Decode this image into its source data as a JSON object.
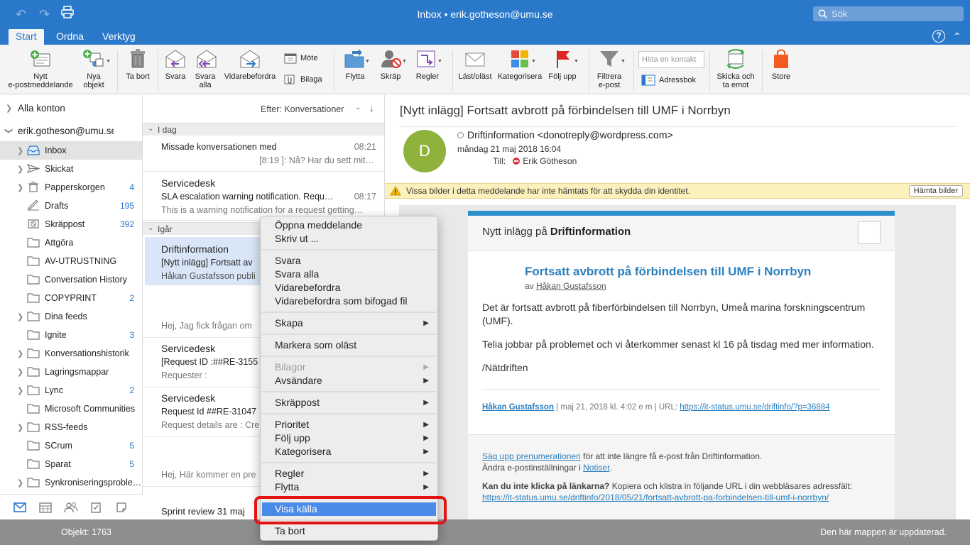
{
  "titlebar": {
    "title": "Inbox • erik.gotheson@umu.se",
    "search_placeholder": "Sök"
  },
  "ribbon_tabs": [
    "Start",
    "Ordna",
    "Verktyg"
  ],
  "ribbon": {
    "new_email": [
      "Nytt",
      "e-postmeddelande"
    ],
    "new_items": [
      "Nya",
      "objekt"
    ],
    "delete": "Ta bort",
    "reply": "Svara",
    "reply_all": [
      "Svara",
      "alla"
    ],
    "forward": "Vidarebefordra",
    "meeting": "Möte",
    "attachment": "Bilaga",
    "move": "Flytta",
    "junk": "Skräp",
    "rules": "Regler",
    "read_unread": "Läst/oläst",
    "categorize": "Kategorisera",
    "follow_up": "Följ upp",
    "filter": [
      "Filtrera",
      "e-post"
    ],
    "people_search_placeholder": "Hitta en kontakt",
    "address_book": "Adressbok",
    "send_receive": [
      "Skicka och",
      "ta emot"
    ],
    "store": "Store"
  },
  "sidebar": {
    "all_accounts": "Alla konton",
    "account": "erik.gotheson@umu.se",
    "folders": [
      {
        "label": "Inbox",
        "count": "",
        "icon": "inbox-icon"
      },
      {
        "label": "Skickat",
        "count": "",
        "icon": "sent-icon"
      },
      {
        "label": "Papperskorgen",
        "count": "4",
        "icon": "trash-icon"
      },
      {
        "label": "Drafts",
        "count": "195",
        "icon": "drafts-icon"
      },
      {
        "label": "Skräppost",
        "count": "392",
        "icon": "junk-icon"
      },
      {
        "label": "Attgöra",
        "count": "",
        "icon": "folder-icon"
      },
      {
        "label": "AV-UTRUSTNING",
        "count": "",
        "icon": "folder-icon"
      },
      {
        "label": "Conversation History",
        "count": "",
        "icon": "folder-icon"
      },
      {
        "label": "COPYPRINT",
        "count": "2",
        "icon": "folder-icon"
      },
      {
        "label": "Dina feeds",
        "count": "",
        "icon": "folder-icon"
      },
      {
        "label": "Ignite",
        "count": "3",
        "icon": "folder-icon"
      },
      {
        "label": "Konversationshistorik",
        "count": "",
        "icon": "folder-icon"
      },
      {
        "label": "Lagringsmappar",
        "count": "",
        "icon": "folder-icon"
      },
      {
        "label": "Lync",
        "count": "2",
        "icon": "folder-icon"
      },
      {
        "label": "Microsoft Communities",
        "count": "",
        "icon": "folder-icon"
      },
      {
        "label": "RSS-feeds",
        "count": "",
        "icon": "folder-icon"
      },
      {
        "label": "SCrum",
        "count": "5",
        "icon": "folder-icon"
      },
      {
        "label": "Sparat",
        "count": "5",
        "icon": "folder-icon"
      },
      {
        "label": "Synkroniseringsproble…",
        "count": "",
        "icon": "folder-icon"
      }
    ]
  },
  "message_list": {
    "sort_label": "Efter: Konversationer",
    "group_today": "I dag",
    "group_yesterday": "Igår",
    "messages": [
      {
        "from": "",
        "subject": "Missade konversationen med",
        "preview": "[8:19 ]: Nå? Har du sett mit…",
        "time": "08:21"
      },
      {
        "from": "Servicedesk",
        "subject": "SLA escalation warning notification. Requ…",
        "preview": "This is a warning notification for a request getting…",
        "time": "08:17"
      },
      {
        "from": "Driftinformation",
        "subject": "[Nytt inlägg] Fortsatt av",
        "preview": "Håkan Gustafsson publi",
        "time": ""
      },
      {
        "from": "",
        "subject": "",
        "preview": "Hej, Jag fick frågan om",
        "time": ""
      },
      {
        "from": "Servicedesk",
        "subject": "[Request ID :##RE-3155",
        "preview": "Requester :",
        "time": ""
      },
      {
        "from": "Servicedesk",
        "subject": "Request Id ##RE-31047",
        "preview": "Request details are : Cre",
        "time": ""
      },
      {
        "from": "",
        "subject": "",
        "preview": "Hej, Här kommer en pre",
        "time": ""
      },
      {
        "from": "",
        "subject": "Sprint review 31 maj",
        "preview": "",
        "time": ""
      }
    ]
  },
  "reading_pane": {
    "subject": "[Nytt inlägg] Fortsatt avbrott på förbindelsen till UMF i Norrbyn",
    "avatar_letter": "D",
    "sender": "Driftinformation <donotreply@wordpress.com>",
    "date": "måndag 21 maj 2018 16:04",
    "to_label": "Till:",
    "to_name": "Erik Götheson",
    "info_bar": "Vissa bilder i detta meddelande har inte hämtats för att skydda din identitet.",
    "load_images": "Hämta bilder",
    "card_head_prefix": "Nytt inlägg på ",
    "card_head_site": "Driftinformation",
    "post_title": "Fortsatt avbrott på förbindelsen till UMF i Norrbyn",
    "post_by_prefix": "av ",
    "post_author": "Håkan Gustafsson",
    "paragraph1": "Det är fortsatt avbrott på fiberförbindelsen till Norrbyn, Umeå marina forskningscentrum (UMF).",
    "paragraph2": "Telia jobbar på problemet och vi återkommer senast kl 16 på tisdag med mer information.",
    "signature": "/Nätdriften",
    "meta_author": "Håkan Gustafsson",
    "meta_middle": " | maj 21, 2018 kl. 4:02 e m | URL: ",
    "meta_url": "https://it-status.umu.se/driftinfo/?p=36884",
    "footer_unsub_link": "Säg upp prenumerationen",
    "footer_unsub_rest": " för att inte längre få e-post från Driftinformation.",
    "footer_settings_prefix": "Ändra e-postinställningar i ",
    "footer_settings_link": "Notiser",
    "footer_settings_suffix": ".",
    "footer_cant_click_bold": "Kan du inte klicka på länkarna?",
    "footer_cant_click_rest": " Kopiera och klistra in följande URL i din webbläsares adressfält:",
    "footer_url": "https://it-status.umu.se/driftinfo/2018/05/21/fortsatt-avbrott-pa-forbindelsen-till-umf-i-norrbyn/"
  },
  "context_menu": {
    "open": "Öppna meddelande",
    "print": "Skriv ut ...",
    "reply": "Svara",
    "reply_all": "Svara alla",
    "forward": "Vidarebefordra",
    "forward_attachment": "Vidarebefordra som bifogad fil",
    "create": "Skapa",
    "mark_unread": "Markera som oläst",
    "attachments": "Bilagor",
    "sender": "Avsändare",
    "junk": "Skräppost",
    "priority": "Prioritet",
    "follow_up": "Följ upp",
    "categorize": "Kategorisera",
    "rules": "Regler",
    "move": "Flytta",
    "view_source": "Visa källa",
    "delete": "Ta bort",
    "submenu_arrow": "▶"
  },
  "statusbar": {
    "items": "Objekt: 1763",
    "status": "Den här mappen är uppdaterad."
  },
  "colors": {
    "accent": "#2a78c9",
    "highlight": "#4a8ae8",
    "annotation_ring": "#e51212",
    "avatar": "#8fb23d"
  }
}
